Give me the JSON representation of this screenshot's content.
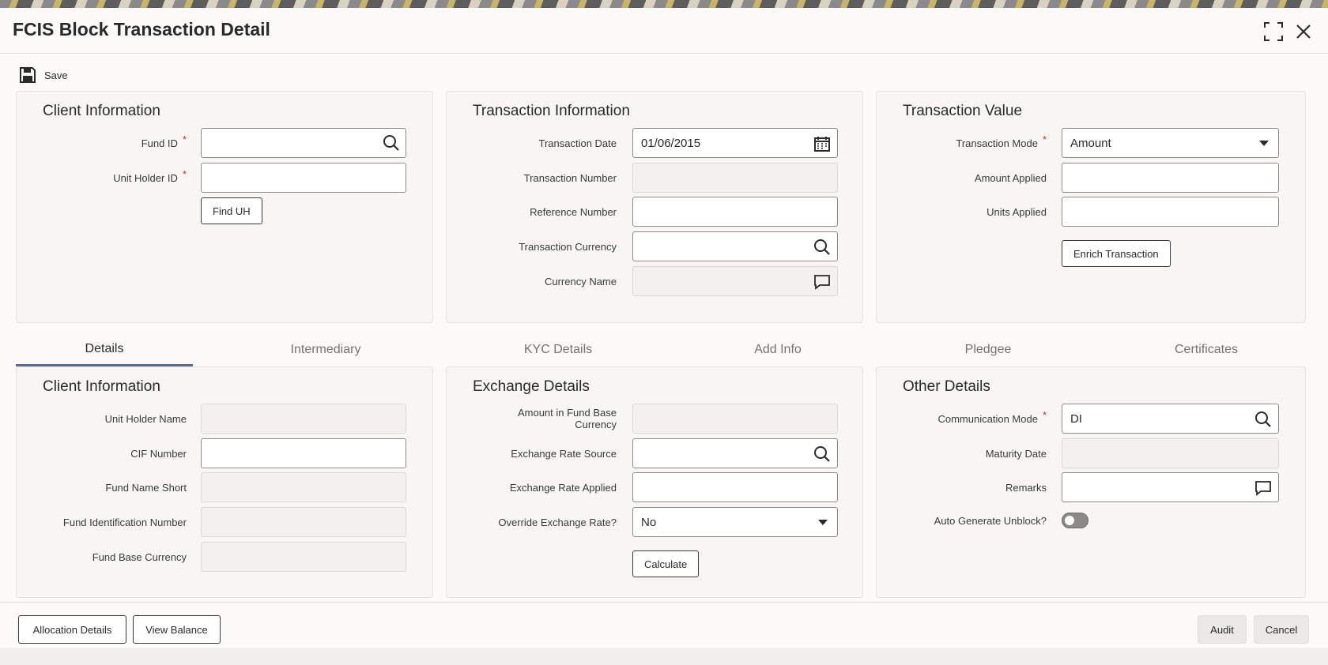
{
  "window": {
    "title": "FCIS Block Transaction Detail"
  },
  "toolbar": {
    "save_label": "Save"
  },
  "client_info": {
    "title": "Client Information",
    "fund_id_label": "Fund ID",
    "fund_id_value": "",
    "unit_holder_id_label": "Unit Holder ID",
    "unit_holder_id_value": "",
    "find_uh_label": "Find UH",
    "required_mark": "*"
  },
  "transaction_info": {
    "title": "Transaction Information",
    "transaction_date_label": "Transaction Date",
    "transaction_date_value": "01/06/2015",
    "transaction_number_label": "Transaction Number",
    "reference_number_label": "Reference Number",
    "transaction_currency_label": "Transaction Currency",
    "currency_name_label": "Currency Name"
  },
  "transaction_value": {
    "title": "Transaction Value",
    "transaction_mode_label": "Transaction Mode",
    "transaction_mode_value": "Amount",
    "amount_applied_label": "Amount Applied",
    "units_applied_label": "Units Applied",
    "enrich_label": "Enrich Transaction"
  },
  "tabs": [
    {
      "label": "Details"
    },
    {
      "label": "Intermediary"
    },
    {
      "label": "KYC Details"
    },
    {
      "label": "Add Info"
    },
    {
      "label": "Pledgee"
    },
    {
      "label": "Certificates"
    }
  ],
  "details_client": {
    "title": "Client Information",
    "unit_holder_name_label": "Unit Holder Name",
    "cif_number_label": "CIF Number",
    "fund_name_short_label": "Fund Name Short",
    "fund_identification_number_label": "Fund Identification Number",
    "fund_base_currency_label": "Fund Base Currency"
  },
  "exchange": {
    "title": "Exchange Details",
    "amount_fund_base_label": "Amount in Fund Base Currency",
    "exchange_rate_source_label": "Exchange Rate Source",
    "exchange_rate_applied_label": "Exchange Rate Applied",
    "override_label": "Override Exchange Rate?",
    "override_value": "No",
    "calculate_label": "Calculate"
  },
  "other": {
    "title": "Other Details",
    "communication_mode_label": "Communication Mode",
    "communication_mode_value": "DI",
    "maturity_date_label": "Maturity Date",
    "remarks_label": "Remarks",
    "auto_unblock_label": "Auto Generate Unblock?",
    "auto_unblock_on": false
  },
  "footer": {
    "allocation_label": "Allocation Details",
    "view_balance_label": "View Balance",
    "audit_label": "Audit",
    "cancel_label": "Cancel"
  }
}
